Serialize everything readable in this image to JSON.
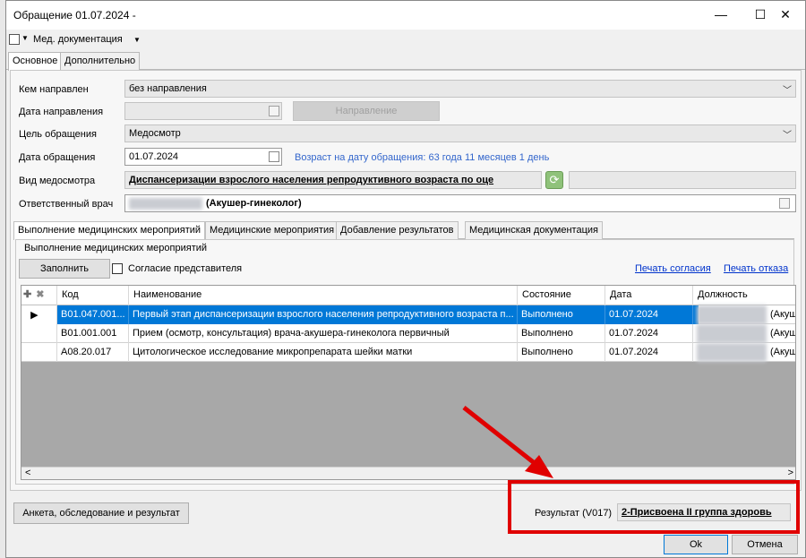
{
  "window": {
    "title": "Обращение 01.07.2024 -",
    "minimize": "—",
    "maximize": "☐",
    "close": "✕"
  },
  "toolbar": {
    "doc_menu_label": "Мед. документация"
  },
  "main_tabs": [
    {
      "label": "Основное",
      "active": true
    },
    {
      "label": "Дополнительно",
      "active": false
    }
  ],
  "form": {
    "referred_by": {
      "label": "Кем направлен",
      "value": "без направления"
    },
    "referral_date": {
      "label": "Дата направления",
      "value": "",
      "button": "Направление"
    },
    "purpose": {
      "label": "Цель обращения",
      "value": "Медосмотр"
    },
    "visit_date": {
      "label": "Дата обращения",
      "value": "01.07.2024",
      "age_text": "Возраст на дату обращения:  63 года 11 месяцев 1 день"
    },
    "exam_type": {
      "label": "Вид медосмотра",
      "value": "Диспансеризации взрослого населения репродуктивного возраста по оце"
    },
    "doctor": {
      "label": "Ответственный врач",
      "value": "(Акушер-гинеколог)"
    }
  },
  "sub_tabs": [
    {
      "label": "Выполнение медицинских мероприятий",
      "active": true
    },
    {
      "label": "Медицинские мероприятия",
      "active": false
    },
    {
      "label": "Добавление результатов",
      "active": false
    },
    {
      "label": "Медицинская документация",
      "active": false
    }
  ],
  "group": {
    "title": "Выполнение медицинских мероприятий",
    "fill_button": "Заполнить",
    "consent_checkbox": "Согласие представителя",
    "print_consent": "Печать согласия",
    "print_refusal": "Печать отказа"
  },
  "grid": {
    "columns": [
      "Код",
      "Наименование",
      "Состояние",
      "Дата",
      "Должность"
    ],
    "rows": [
      {
        "code": "B01.047.001...",
        "name": "Первый этап диспансеризации взрослого населения репродуктивного возраста п...",
        "status": "Выполнено",
        "date": "01.07.2024",
        "position": "(Акуш"
      },
      {
        "code": "B01.001.001",
        "name": "Прием (осмотр, консультация) врача-акушера-гинеколога первичный",
        "status": "Выполнено",
        "date": "01.07.2024",
        "position": "(Акуш"
      },
      {
        "code": "A08.20.017",
        "name": "Цитологическое исследование микропрепарата шейки матки",
        "status": "Выполнено",
        "date": "01.07.2024",
        "position": "(Акуш"
      }
    ]
  },
  "bottom": {
    "anketa_button": "Анкета, обследование и результат",
    "result_label": "Результат (V017)",
    "result_value": "2-Присвоена II группа здоровь",
    "ok_button": "Ok",
    "cancel_button": "Отмена"
  },
  "colors": {
    "selection": "#0078d7",
    "highlight_red": "#e00000",
    "link": "#0033cc"
  }
}
